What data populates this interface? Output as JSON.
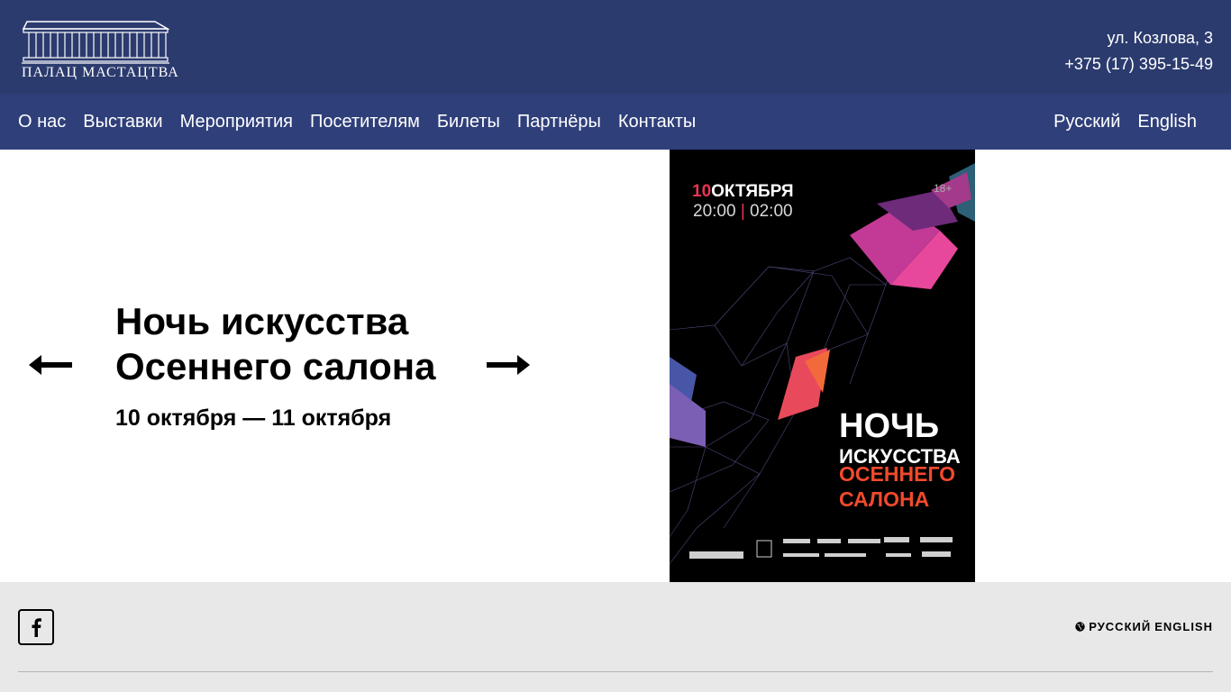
{
  "header": {
    "logo_text": "ПАЛАЦ МАСТАЦТВА",
    "address": "ул. Козлова, 3",
    "phone": "+375 (17) 395-15-49"
  },
  "nav": {
    "items": [
      "О нас",
      "Выставки",
      "Мероприятия",
      "Посетителям",
      "Билеты",
      "Партнёры",
      "Контакты"
    ],
    "languages": [
      "Русский",
      "English"
    ]
  },
  "hero": {
    "title_line1": "Ночь искусства",
    "title_line2": "Осеннего салона",
    "dates": "10 октября — 11 октября",
    "prev_icon": "arrow-left-icon",
    "next_icon": "arrow-right-icon"
  },
  "poster": {
    "date_number": "10",
    "date_month": "ОКТЯБРЯ",
    "time_start": "20:00",
    "time_separator": "|",
    "time_end": "02:00",
    "age": "18+",
    "title_line1": "НОЧЬ",
    "title_line2": "ИСКУССТВА",
    "title_line3": "ОСЕННЕГО",
    "title_line4": "САЛОНА"
  },
  "footer": {
    "social_icon": "facebook-icon",
    "lang_icon": "globe-icon",
    "languages": [
      "РУССКИЙ",
      "ENGLISH"
    ]
  },
  "colors": {
    "topbar": "#2b3b6e",
    "navbar": "#2f3f7a",
    "footer": "#e8e8e8",
    "poster_accent_red": "#e8344f",
    "poster_accent_orange": "#f04a2c"
  }
}
